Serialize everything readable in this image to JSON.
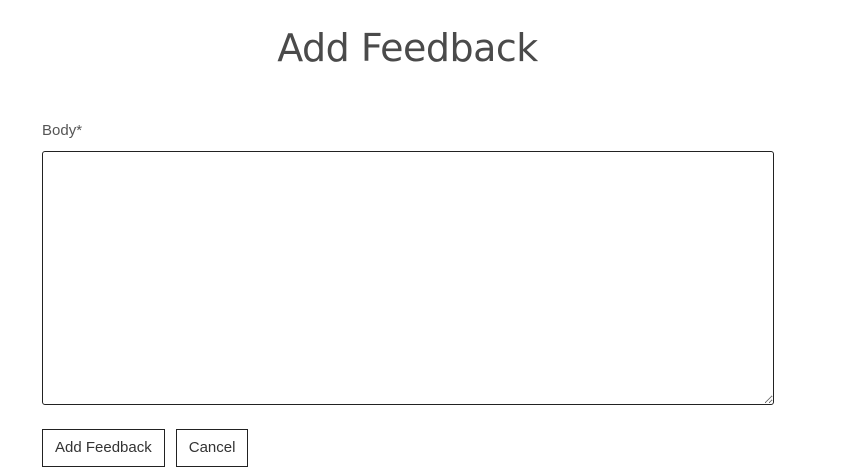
{
  "page": {
    "title": "Add Feedback"
  },
  "form": {
    "body_label": "Body*",
    "body_value": ""
  },
  "actions": {
    "submit_label": "Add Feedback",
    "cancel_label": "Cancel"
  }
}
